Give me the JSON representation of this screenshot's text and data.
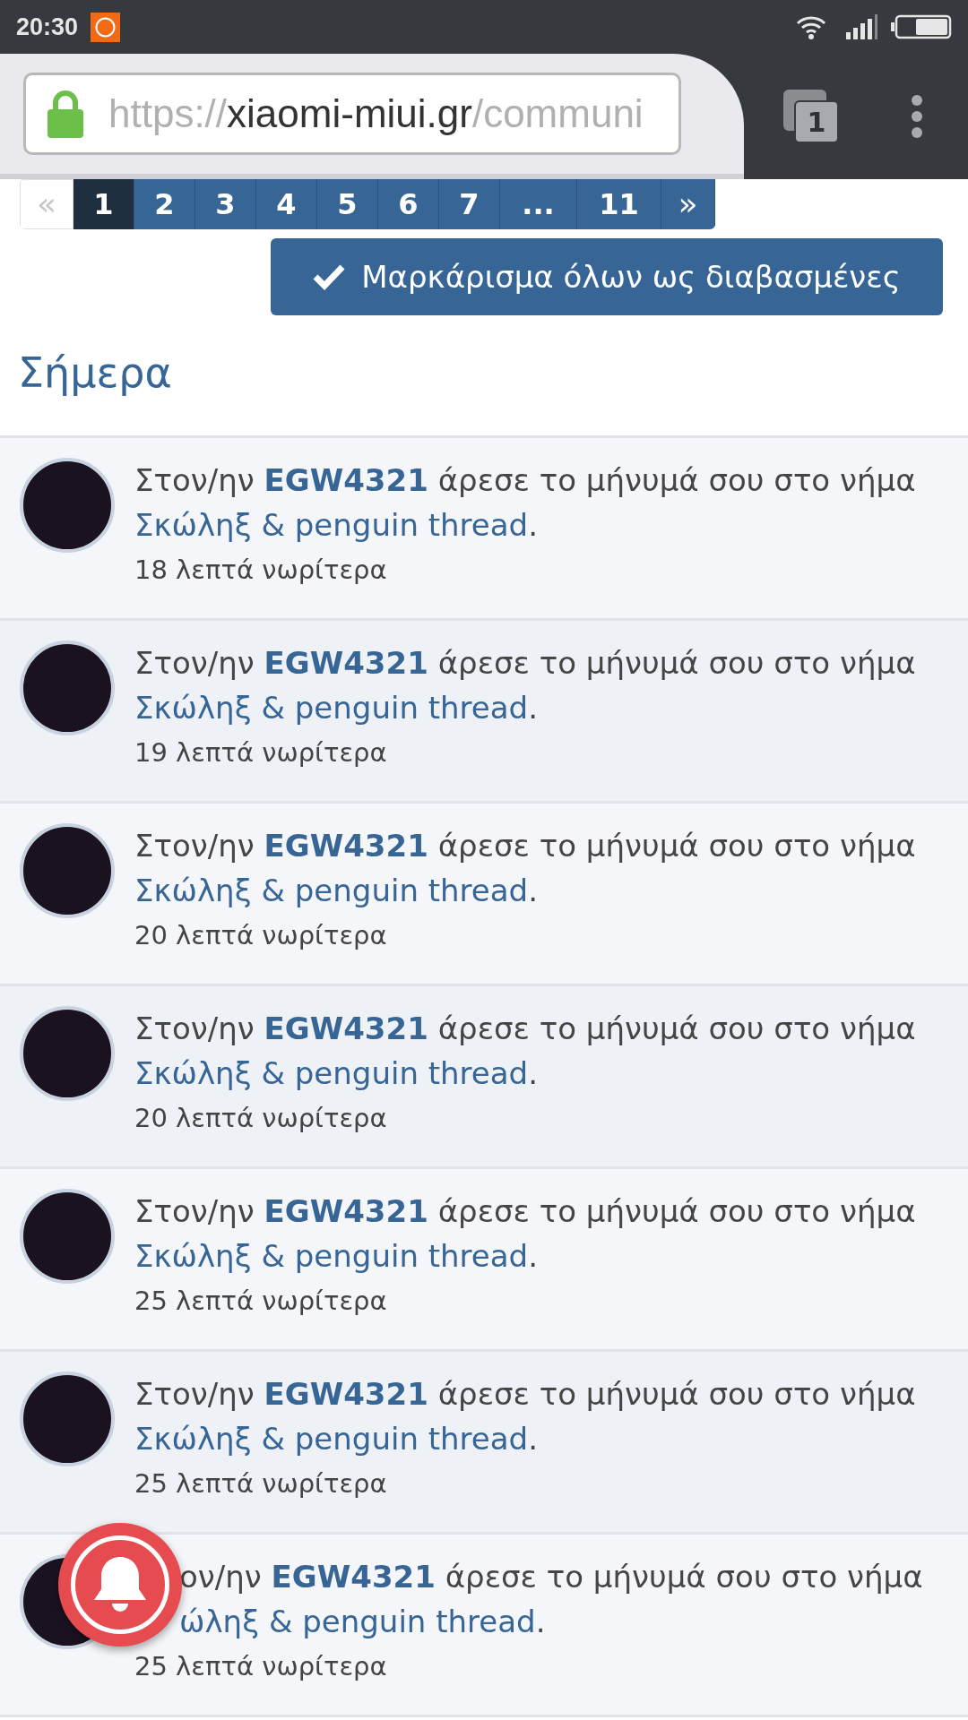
{
  "status_bar": {
    "time": "20:30"
  },
  "browser": {
    "url_scheme": "https://",
    "url_host": "xiaomi-miui.gr",
    "url_path": "/communi",
    "tab_count": "1"
  },
  "pagination": [
    {
      "label": "«",
      "kind": "prev",
      "selected": false,
      "disabled": true
    },
    {
      "label": "1",
      "kind": "page",
      "selected": true,
      "disabled": false
    },
    {
      "label": "2",
      "kind": "page",
      "selected": false,
      "disabled": false
    },
    {
      "label": "3",
      "kind": "page",
      "selected": false,
      "disabled": false
    },
    {
      "label": "4",
      "kind": "page",
      "selected": false,
      "disabled": false
    },
    {
      "label": "5",
      "kind": "page",
      "selected": false,
      "disabled": false
    },
    {
      "label": "6",
      "kind": "page",
      "selected": false,
      "disabled": false
    },
    {
      "label": "7",
      "kind": "page",
      "selected": false,
      "disabled": false
    },
    {
      "label": "...",
      "kind": "ellipsis",
      "selected": false,
      "disabled": false
    },
    {
      "label": "11",
      "kind": "page",
      "selected": false,
      "disabled": false
    },
    {
      "label": "»",
      "kind": "next",
      "selected": false,
      "disabled": false
    }
  ],
  "mark_all_button": "Μαρκάρισμα όλων ως διαβασμένες",
  "section_title": "Σήμερα",
  "notifications": [
    {
      "prefix": "Στον/ην",
      "user": "EGW4321",
      "text": "άρεσε το μήνυμά σου στο νήμα",
      "thread": "Σκώληξ & penguin thread",
      "suffix": ".",
      "time": "18 λεπτά νωρίτερα",
      "under_bell": false
    },
    {
      "prefix": "Στον/ην",
      "user": "EGW4321",
      "text": "άρεσε το μήνυμά σου στο νήμα",
      "thread": "Σκώληξ & penguin thread",
      "suffix": ".",
      "time": "19 λεπτά νωρίτερα",
      "under_bell": false
    },
    {
      "prefix": "Στον/ην",
      "user": "EGW4321",
      "text": "άρεσε το μήνυμά σου στο νήμα",
      "thread": "Σκώληξ & penguin thread",
      "suffix": ".",
      "time": "20 λεπτά νωρίτερα",
      "under_bell": false
    },
    {
      "prefix": "Στον/ην",
      "user": "EGW4321",
      "text": "άρεσε το μήνυμά σου στο νήμα",
      "thread": "Σκώληξ & penguin thread",
      "suffix": ".",
      "time": "20 λεπτά νωρίτερα",
      "under_bell": false
    },
    {
      "prefix": "Στον/ην",
      "user": "EGW4321",
      "text": "άρεσε το μήνυμά σου στο νήμα",
      "thread": "Σκώληξ & penguin thread",
      "suffix": ".",
      "time": "25 λεπτά νωρίτερα",
      "under_bell": false
    },
    {
      "prefix": "Στον/ην",
      "user": "EGW4321",
      "text": "άρεσε το μήνυμά σου στο νήμα",
      "thread": "Σκώληξ & penguin thread",
      "suffix": ".",
      "time": "25 λεπτά νωρίτερα",
      "under_bell": false
    },
    {
      "prefix": "ον/ην",
      "user": "EGW4321",
      "text": "άρεσε το μήνυμά σου στο νήμα",
      "thread": "ώληξ & penguin thread",
      "suffix": ".",
      "time": "25 λεπτά νωρίτερα",
      "under_bell": true
    }
  ]
}
